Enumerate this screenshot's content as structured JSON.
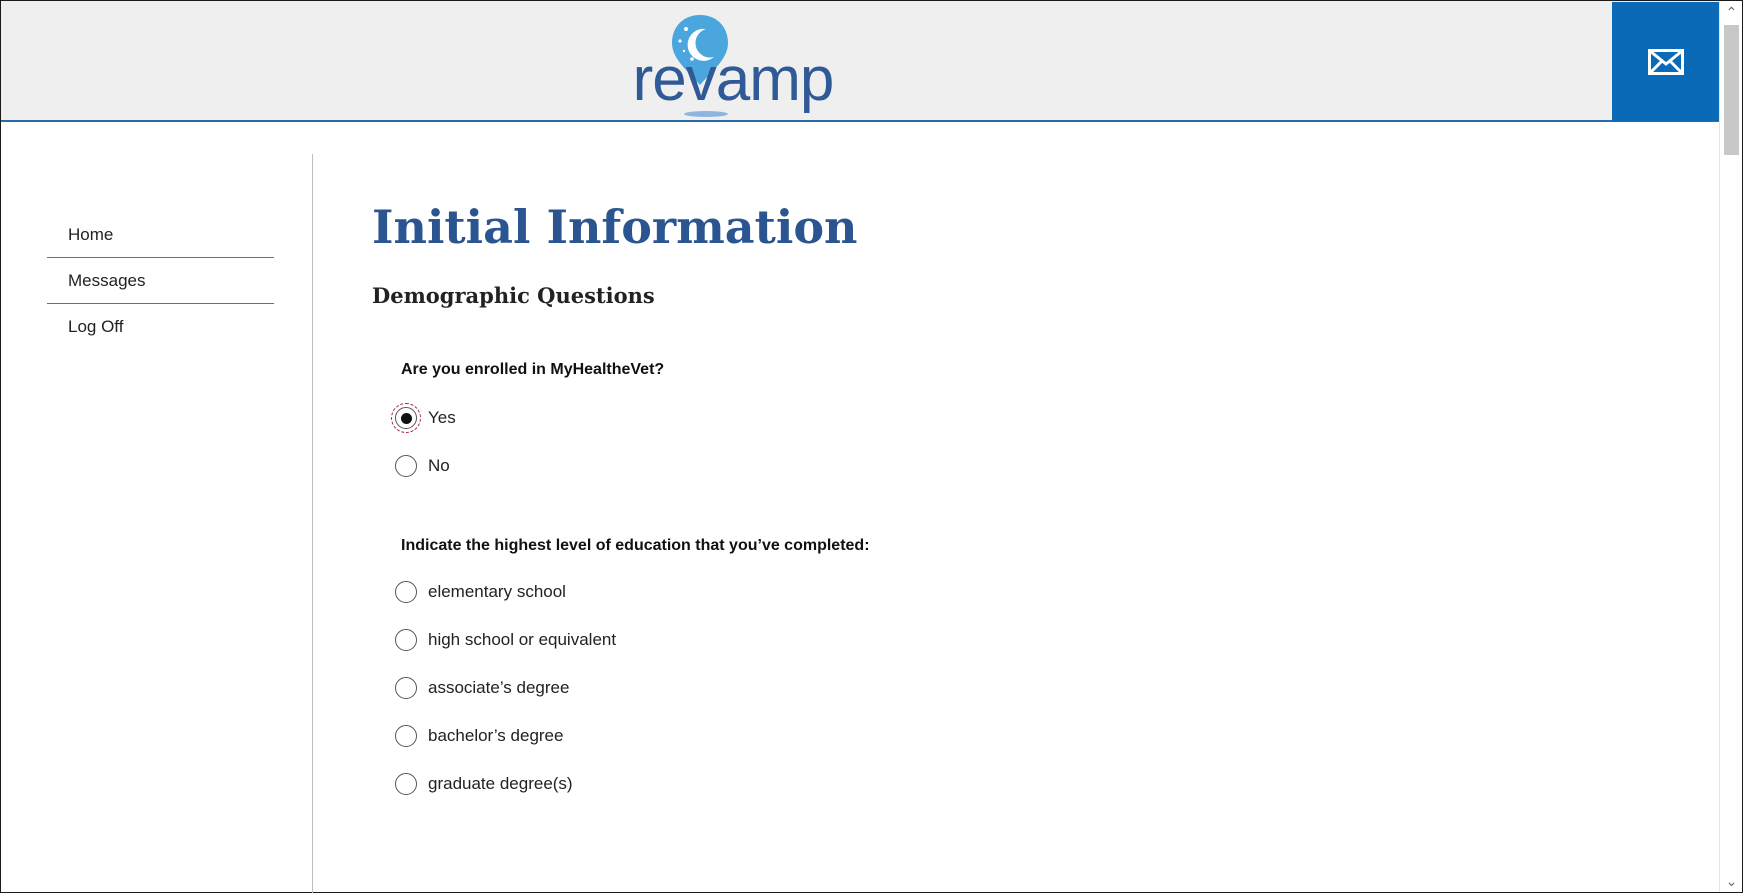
{
  "header": {
    "logo_text": "revamp",
    "logo_icon": "moon-pin-icon",
    "mail_icon": "mail-envelope-icon",
    "accent_color": "#0a6ab7"
  },
  "sidebar": {
    "items": [
      {
        "label": "Home"
      },
      {
        "label": "Messages"
      },
      {
        "label": "Log Off"
      }
    ]
  },
  "main": {
    "title": "Initial Information",
    "section_title": "Demographic Questions",
    "questions": [
      {
        "text": "Are you enrolled in MyHealtheVet?",
        "options": [
          {
            "label": "Yes",
            "selected": true
          },
          {
            "label": "No",
            "selected": false
          }
        ]
      },
      {
        "text": "Indicate the highest level of education that you’ve completed:",
        "options": [
          {
            "label": "elementary school",
            "selected": false
          },
          {
            "label": "high school or equivalent",
            "selected": false
          },
          {
            "label": "associate’s degree",
            "selected": false
          },
          {
            "label": "bachelor’s degree",
            "selected": false
          },
          {
            "label": "graduate degree(s)",
            "selected": false
          }
        ]
      }
    ]
  }
}
